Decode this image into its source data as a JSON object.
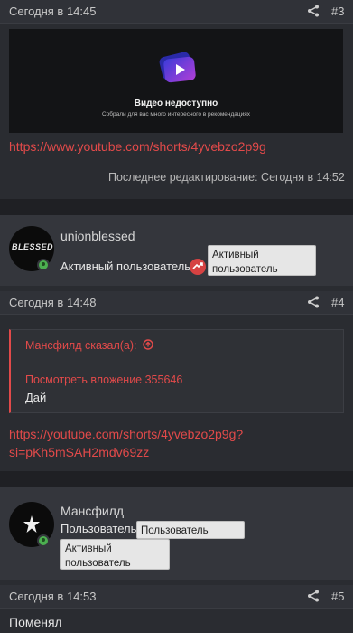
{
  "post3": {
    "date": "Сегодня в 14:45",
    "number": "#3",
    "video_title": "Видео недоступно",
    "video_subtitle": "Собрали для вас много интересного в рекомендациях",
    "link": "https://www.youtube.com/shorts/4yvebzo2p9g",
    "edited": "Последнее редактирование: Сегодня в 14:52"
  },
  "user1": {
    "avatar_text": "BLESSED",
    "name": "unionblessed",
    "role": "Активный пользователь",
    "tooltip": "Активный пользователь"
  },
  "post4": {
    "date": "Сегодня в 14:48",
    "number": "#4",
    "quote_author": "Мансфилд сказал(а):",
    "quote_attachment": "Посмотреть вложение 355646",
    "quote_text": "Дай",
    "link_line1": "https://youtube.com/shorts/4yvebzo2p9g?",
    "link_line2": "si=pKh5mSAH2mdv69zz"
  },
  "user2": {
    "name": "Мансфилд",
    "role": "Пользователь",
    "tooltip1": "Пользователь",
    "tooltip2": "Активный пользователь"
  },
  "post5": {
    "date": "Сегодня в 14:53",
    "number": "#5",
    "text": "Поменял"
  },
  "colors": {
    "accent": "#e24a4a",
    "background": "#2a2c31",
    "online": "#4caf50"
  },
  "icons": [
    "share-icon",
    "online-indicator",
    "arrow-up-circle-icon",
    "badge-icon",
    "play-icon"
  ]
}
